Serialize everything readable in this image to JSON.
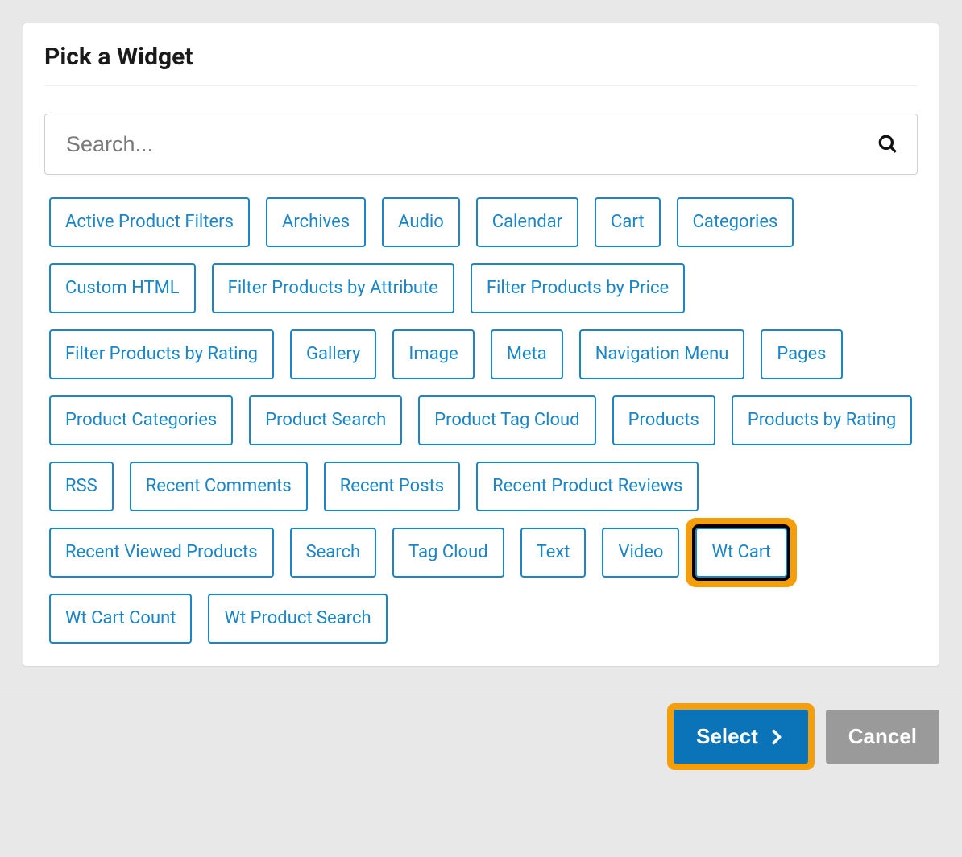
{
  "panel": {
    "title": "Pick a Widget"
  },
  "search": {
    "placeholder": "Search..."
  },
  "colors": {
    "accent": "#1b85c6",
    "highlight": "#f59e0b",
    "primary_btn": "#0b73b7",
    "secondary_btn": "#9a9a9a"
  },
  "widgets": [
    {
      "label": "Active Product Filters"
    },
    {
      "label": "Archives"
    },
    {
      "label": "Audio"
    },
    {
      "label": "Calendar"
    },
    {
      "label": "Cart"
    },
    {
      "label": "Categories"
    },
    {
      "label": "Custom HTML"
    },
    {
      "label": "Filter Products by Attribute"
    },
    {
      "label": "Filter Products by Price"
    },
    {
      "label": "Filter Products by Rating"
    },
    {
      "label": "Gallery"
    },
    {
      "label": "Image"
    },
    {
      "label": "Meta"
    },
    {
      "label": "Navigation Menu"
    },
    {
      "label": "Pages"
    },
    {
      "label": "Product Categories"
    },
    {
      "label": "Product Search"
    },
    {
      "label": "Product Tag Cloud"
    },
    {
      "label": "Products"
    },
    {
      "label": "Products by Rating"
    },
    {
      "label": "RSS"
    },
    {
      "label": "Recent Comments"
    },
    {
      "label": "Recent Posts"
    },
    {
      "label": "Recent Product Reviews"
    },
    {
      "label": "Recent Viewed Products"
    },
    {
      "label": "Search"
    },
    {
      "label": "Tag Cloud"
    },
    {
      "label": "Text"
    },
    {
      "label": "Video"
    },
    {
      "label": "Wt Cart",
      "highlighted": true
    },
    {
      "label": "Wt Cart Count"
    },
    {
      "label": "Wt Product Search"
    }
  ],
  "footer": {
    "select_label": "Select",
    "select_highlighted": true,
    "cancel_label": "Cancel"
  },
  "icons": {
    "search": "search-icon",
    "chevron_right": "chevron-right-icon"
  }
}
